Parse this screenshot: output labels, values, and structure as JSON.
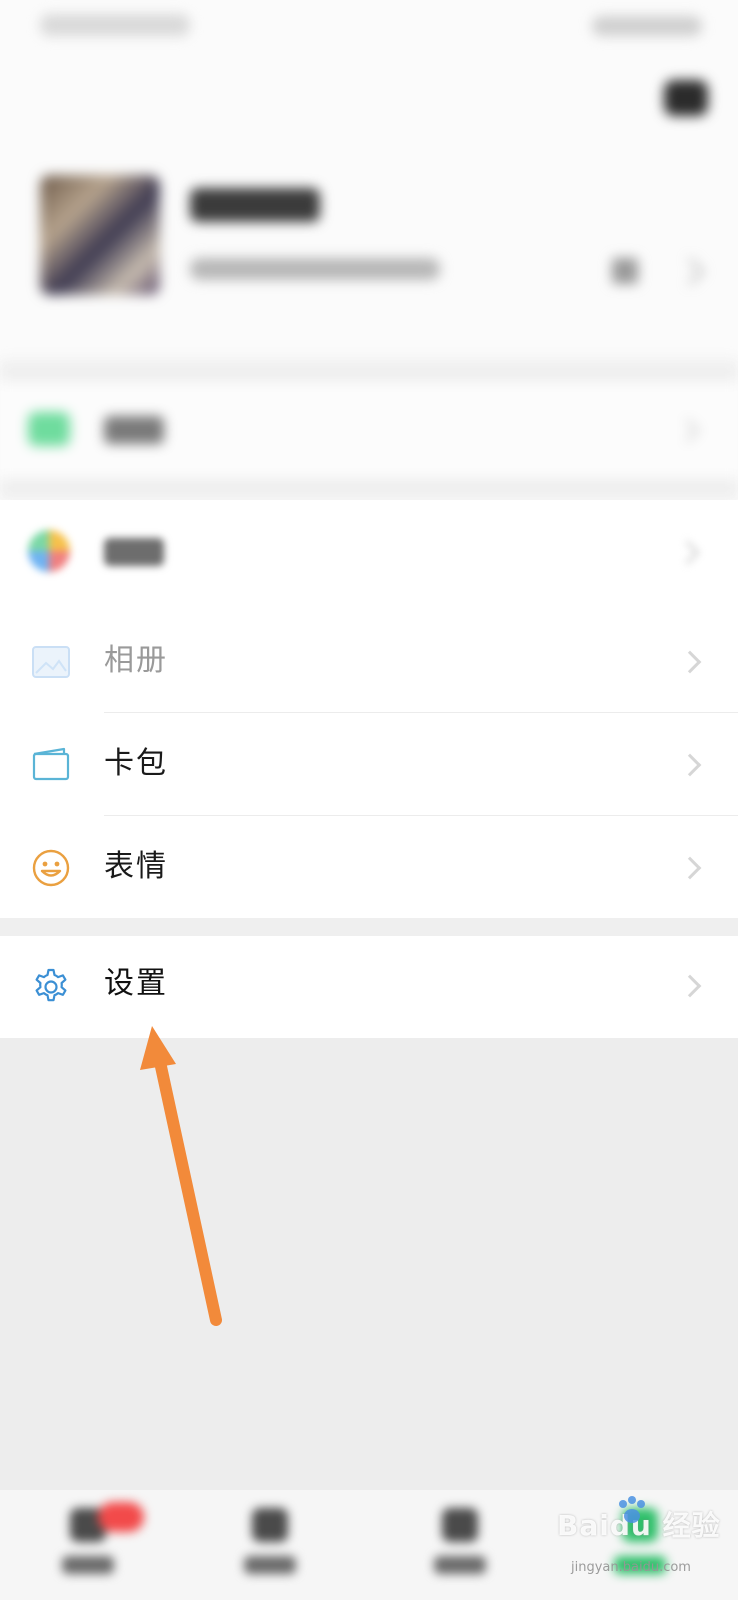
{
  "profile": {
    "name": "",
    "wechat_id": ""
  },
  "menu": {
    "album": {
      "label": "相册",
      "icon": "album-icon"
    },
    "cards": {
      "label": "卡包",
      "icon": "card-wallet-icon"
    },
    "stickers": {
      "label": "表情",
      "icon": "smiley-icon"
    },
    "settings": {
      "label": "设置",
      "icon": "gear-icon"
    }
  },
  "watermark": {
    "brand": "Baidu",
    "brand_cn": "经验",
    "url": "jingyan.baidu.com"
  },
  "colors": {
    "accent_green": "#2fbf6a",
    "settings_icon": "#3b8fd4",
    "cards_icon": "#5ab4d6",
    "stickers_icon": "#eaa040",
    "arrow": "#f28a3a",
    "page_bg": "#ededed"
  }
}
